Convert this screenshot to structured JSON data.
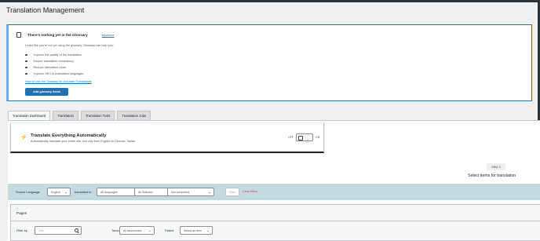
{
  "page": {
    "title": "Translation Management"
  },
  "glossary_notice": {
    "title": "There's nothing yet in the Glossary",
    "dismiss_label": "Minimize",
    "description": "Looks like you're not yet using the glossary. Glossary can help you:",
    "benefits": [
      "Improve the quality of the translation",
      "Ensure translation consistency",
      "Reduce translation costs",
      "Improve SEO in translation languages"
    ],
    "help_link": "How to Use the Glossary for Accurate Translations",
    "button_label": "Add glossary items"
  },
  "tabs": [
    {
      "label": "Translation Dashboard",
      "active": true
    },
    {
      "label": "Translators",
      "active": false
    },
    {
      "label": "Translation Tools",
      "active": false
    },
    {
      "label": "Translation Jobs",
      "active": false
    }
  ],
  "auto_translate": {
    "title": "Translate Everything Automatically",
    "subtitle": "Automatically translate your entire site, but only from English to German, Italian.",
    "toggle_off_label": "OFF",
    "toggle_on_label": "ON",
    "enabled": false
  },
  "step": {
    "badge": "Step 1",
    "title": "Select items for translation"
  },
  "filter_bar": {
    "source_language_label": "Source Language",
    "source_language_value": "English",
    "translated_to_label": "translated to",
    "translated_to_value": "All languages",
    "status_value": "All Statuses",
    "progress_value": "Not completed",
    "filter_button": "Filter",
    "clear_label": "Clear filters"
  },
  "pages_section": {
    "title": "Pages",
    "filter_by_label": "Filter by",
    "search_placeholder": "Title",
    "taxonomy_label": "Taxonomy Term",
    "taxonomy_value": "All taxonomies",
    "parent_label": "Parent",
    "parent_value": "Select an item"
  }
}
